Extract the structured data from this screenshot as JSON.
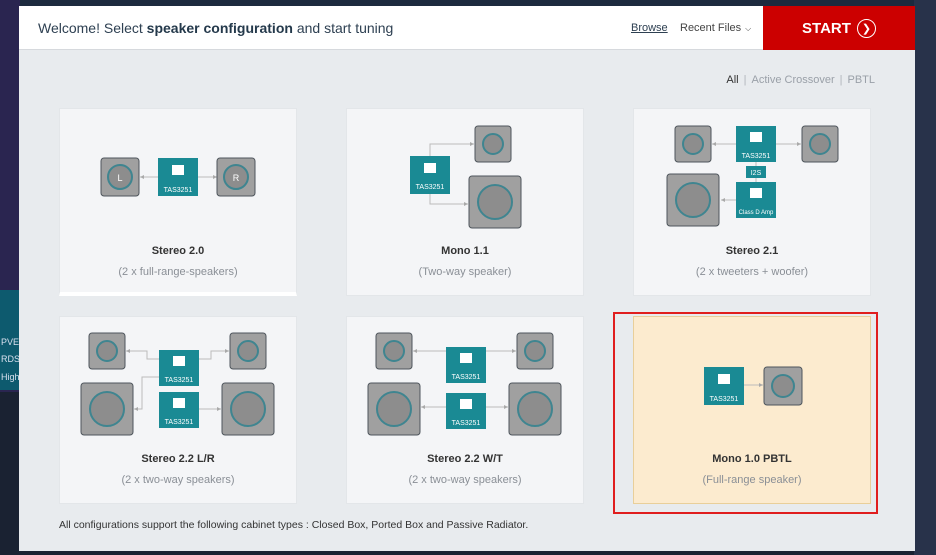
{
  "header": {
    "welcome_prefix": "Welcome! Select ",
    "welcome_bold": "speaker configuration",
    "welcome_suffix": " and start tuning",
    "browse_label": "Browse",
    "recent_label": "Recent Files",
    "start_label": "START"
  },
  "filters": [
    "All",
    "Active Crossover",
    "PBTL"
  ],
  "chip_label": "TAS3251",
  "i2s_label": "I2S",
  "classd_label": "Class D Amp",
  "left_label": "L",
  "right_label": "R",
  "cards": [
    {
      "name": "Stereo 2.0",
      "subtitle": "(2 x full-range-speakers)"
    },
    {
      "name": "Mono 1.1",
      "subtitle": "(Two-way speaker)"
    },
    {
      "name": "Stereo 2.1",
      "subtitle": "(2 x tweeters + woofer)"
    },
    {
      "name": "Stereo 2.2 L/R",
      "subtitle": "(2 x two-way speakers)"
    },
    {
      "name": "Stereo 2.2 W/T",
      "subtitle": "(2 x two-way speakers)"
    },
    {
      "name": "Mono 1.0 PBTL",
      "subtitle": "(Full-range speaker)"
    }
  ],
  "footnote": "All configurations support the following cabinet types : Closed Box, Ported Box and Passive Radiator.",
  "colors": {
    "accent": "#cc0000",
    "chip": "#1a8a94",
    "selected_bg": "#fcebcf",
    "selection_outline": "#e01e1e"
  },
  "background_fragments": [
    "PVE",
    "RDS",
    "High"
  ]
}
